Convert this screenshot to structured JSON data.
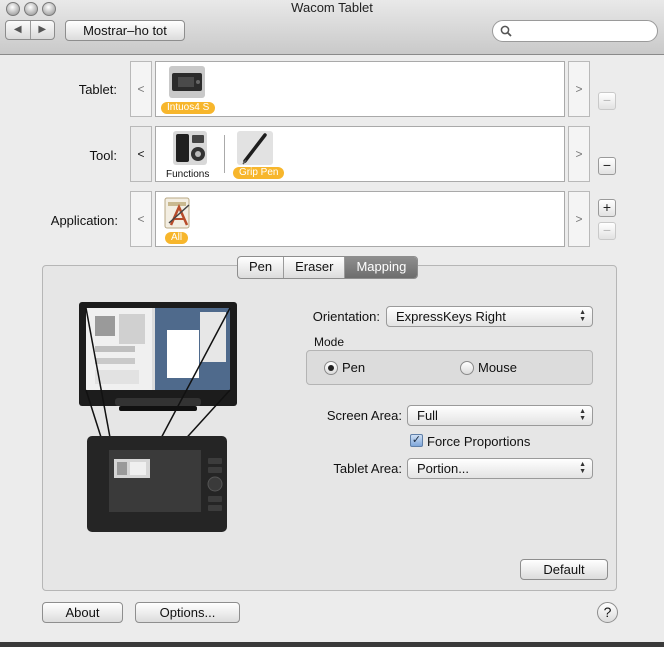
{
  "window": {
    "title": "Wacom Tablet"
  },
  "toolbar": {
    "back_icon": "◀",
    "forward_icon": "▶",
    "show_all_label": "Mostrar–ho tot",
    "search_placeholder": ""
  },
  "rows": {
    "tablet": {
      "label": "Tablet:",
      "items": [
        {
          "name": "Intuos4 S",
          "selected": true
        }
      ]
    },
    "tool": {
      "label": "Tool:",
      "items": [
        {
          "name": "Functions",
          "selected": false
        },
        {
          "name": "Grip Pen",
          "selected": true
        }
      ]
    },
    "application": {
      "label": "Application:",
      "items": [
        {
          "name": "All",
          "selected": true
        }
      ]
    },
    "prev_arrow": "<",
    "next_arrow": ">",
    "add_symbol": "+",
    "remove_symbol": "−"
  },
  "tabs": [
    {
      "label": "Pen",
      "selected": false
    },
    {
      "label": "Eraser",
      "selected": false
    },
    {
      "label": "Mapping",
      "selected": true
    }
  ],
  "mapping": {
    "orientation_label": "Orientation:",
    "orientation_value": "ExpressKeys Right",
    "mode_label": "Mode",
    "mode_pen": "Pen",
    "mode_mouse": "Mouse",
    "mode_selected": "Pen",
    "screen_area_label": "Screen Area:",
    "screen_area_value": "Full",
    "force_proportions_label": "Force Proportions",
    "force_proportions_checked": true,
    "tablet_area_label": "Tablet Area:",
    "tablet_area_value": "Portion...",
    "default_button": "Default"
  },
  "footer": {
    "about_button": "About",
    "options_button": "Options...",
    "help_symbol": "?"
  },
  "colors": {
    "accent": "#f7b62c",
    "selected_tab": "#7d7d7d"
  }
}
